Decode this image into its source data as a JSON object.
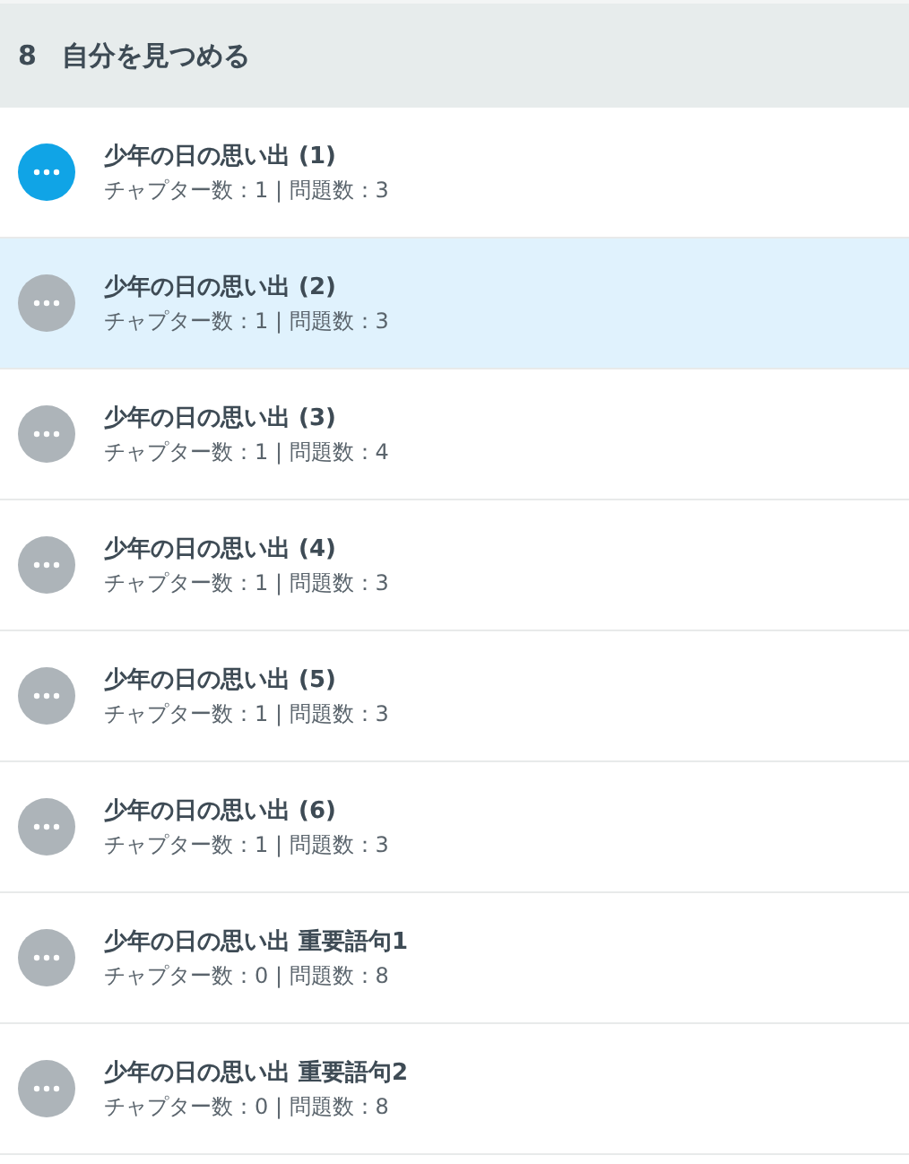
{
  "section": {
    "number": "8",
    "title": "自分を見つめる"
  },
  "lessons": [
    {
      "title": "少年の日の思い出 (1)",
      "meta": "チャプター数：1 | 問題数：3",
      "current": true,
      "selected": false
    },
    {
      "title": "少年の日の思い出 (2)",
      "meta": "チャプター数：1 | 問題数：3",
      "current": false,
      "selected": true
    },
    {
      "title": "少年の日の思い出 (3)",
      "meta": "チャプター数：1 | 問題数：4",
      "current": false,
      "selected": false
    },
    {
      "title": "少年の日の思い出 (4)",
      "meta": "チャプター数：1 | 問題数：3",
      "current": false,
      "selected": false
    },
    {
      "title": "少年の日の思い出 (5)",
      "meta": "チャプター数：1 | 問題数：3",
      "current": false,
      "selected": false
    },
    {
      "title": "少年の日の思い出 (6)",
      "meta": "チャプター数：1 | 問題数：3",
      "current": false,
      "selected": false
    },
    {
      "title": "少年の日の思い出 重要語句1",
      "meta": "チャプター数：0 | 問題数：8",
      "current": false,
      "selected": false
    },
    {
      "title": "少年の日の思い出 重要語句2",
      "meta": "チャプター数：0 | 問題数：8",
      "current": false,
      "selected": false
    }
  ]
}
